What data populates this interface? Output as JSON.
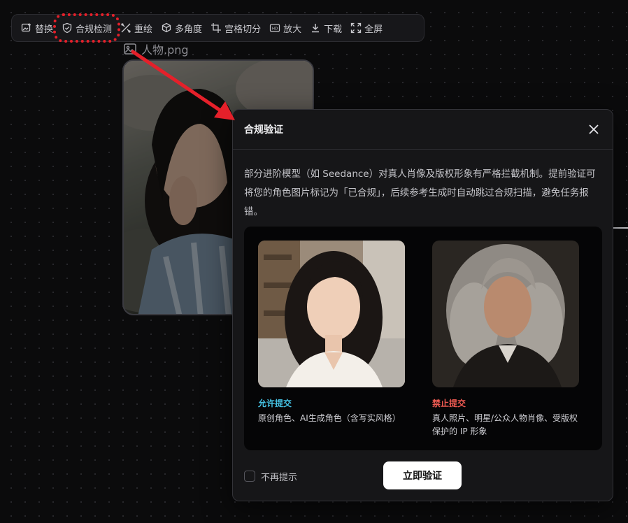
{
  "toolbar": {
    "items": [
      {
        "label": "替换",
        "icon": "replace-image-icon"
      },
      {
        "label": "合规检测",
        "icon": "shield-check-icon"
      },
      {
        "label": "重绘",
        "icon": "redraw-icon"
      },
      {
        "label": "多角度",
        "icon": "multi-angle-icon"
      },
      {
        "label": "宫格切分",
        "icon": "grid-split-icon"
      },
      {
        "label": "放大",
        "icon": "hd-upscale-icon"
      },
      {
        "label": "下载",
        "icon": "download-icon"
      },
      {
        "label": "全屏",
        "icon": "fullscreen-icon"
      }
    ]
  },
  "node": {
    "filename": "人物.png"
  },
  "dialog": {
    "title": "合规验证",
    "description": "部分进阶模型（如 Seedance）对真人肖像及版权形象有严格拦截机制。提前验证可将您的角色图片标记为「已合规」，后续参考生成时自动跳过合规扫描，避免任务报错。",
    "allowed": {
      "tag": "允许提交",
      "desc": "原创角色、AI生成角色（含写实风格）"
    },
    "forbidden": {
      "tag": "禁止提交",
      "desc": "真人照片、明星/公众人物肖像、受版权保护的 IP 形象"
    },
    "dont_show_label": "不再提示",
    "verify_button": "立即验证"
  },
  "colors": {
    "annotation": "#e5202a",
    "allowed": "#45c1e2",
    "forbidden": "#ee5a52"
  }
}
